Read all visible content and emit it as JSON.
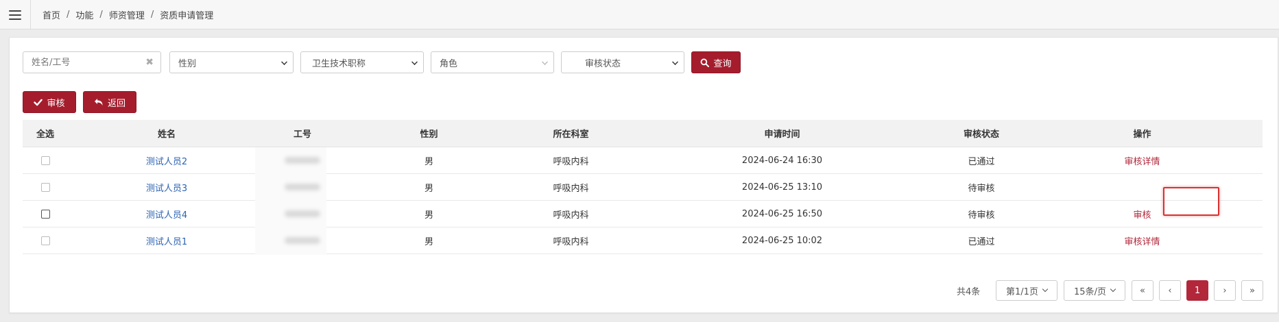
{
  "breadcrumb": [
    "首页",
    "功能",
    "师资管理",
    "资质申请管理"
  ],
  "breadcrumb_sep": "/",
  "filters": {
    "name_placeholder": "姓名/工号",
    "clear_glyph": "✖",
    "gender": "性别",
    "title": "卫生技术职称",
    "role": "角色",
    "status": "审核状态",
    "search_label": "查询"
  },
  "actions": {
    "approve_label": "审核",
    "back_label": "返回"
  },
  "table": {
    "headers": [
      "全选",
      "姓名",
      "工号",
      "性别",
      "所在科室",
      "申请时间",
      "审核状态",
      "操作"
    ],
    "rows": [
      {
        "name": "测试人员2",
        "gender": "男",
        "dept": "呼吸内科",
        "time": "2024-06-24 16:30",
        "status": "已通过",
        "op": "审核详情"
      },
      {
        "name": "测试人员3",
        "gender": "男",
        "dept": "呼吸内科",
        "time": "2024-06-25 13:10",
        "status": "待审核",
        "op": ""
      },
      {
        "name": "测试人员4",
        "gender": "男",
        "dept": "呼吸内科",
        "time": "2024-06-25 16:50",
        "status": "待审核",
        "op": "审核"
      },
      {
        "name": "测试人员1",
        "gender": "男",
        "dept": "呼吸内科",
        "time": "2024-06-25 10:02",
        "status": "已通过",
        "op": "审核详情"
      }
    ]
  },
  "pagination": {
    "total": "共4条",
    "page_select": "第1/1页",
    "size_select": "15条/页",
    "first": "«",
    "prev": "‹",
    "current": "1",
    "next": "›",
    "last": "»"
  },
  "colors": {
    "accent": "#a51d2d",
    "link": "#2c63b3",
    "highlight": "#d93030"
  },
  "icons": {
    "menu": "hamburger-icon",
    "search": "search-icon",
    "check": "check-icon",
    "undo": "undo-icon"
  }
}
